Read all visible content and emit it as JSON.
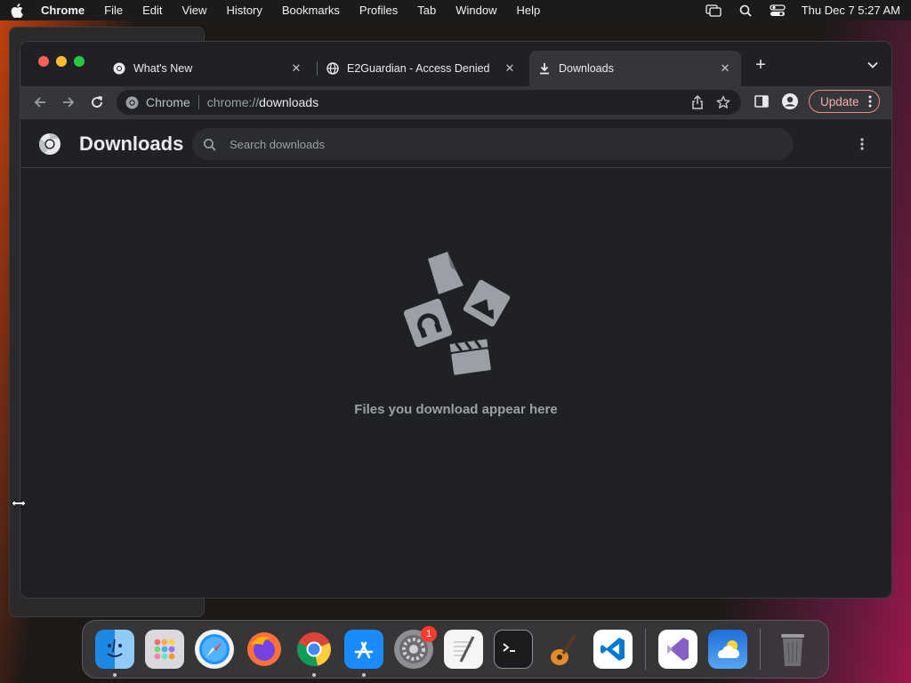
{
  "menubar": {
    "app": "Chrome",
    "items": [
      "File",
      "Edit",
      "View",
      "History",
      "Bookmarks",
      "Profiles",
      "Tab",
      "Window",
      "Help"
    ],
    "datetime": "Thu Dec 7  5:27 AM"
  },
  "tabs": [
    {
      "label": "What's New",
      "icon": "chrome-icon"
    },
    {
      "label": "E2Guardian - Access Denied",
      "icon": "globe-icon"
    },
    {
      "label": "Downloads",
      "icon": "download-icon"
    }
  ],
  "toolbar": {
    "site_chip": "Chrome",
    "url_scheme": "chrome://",
    "url_host": "downloads",
    "update_label": "Update"
  },
  "downloads": {
    "title": "Downloads",
    "search_placeholder": "Search downloads",
    "empty_message": "Files you download appear here"
  },
  "dock": {
    "apps": [
      "Finder",
      "Launchpad",
      "Safari",
      "Firefox",
      "Chrome",
      "App Store",
      "System Settings",
      "TextEdit",
      "Terminal",
      "GarageBand",
      "Visual Studio Code",
      "Visual Studio",
      "Weather",
      "Trash"
    ],
    "system_settings_badge": "1"
  },
  "colors": {
    "window_bg": "#202124",
    "toolbar_bg": "#35363a",
    "update_accent": "#f28b82"
  }
}
